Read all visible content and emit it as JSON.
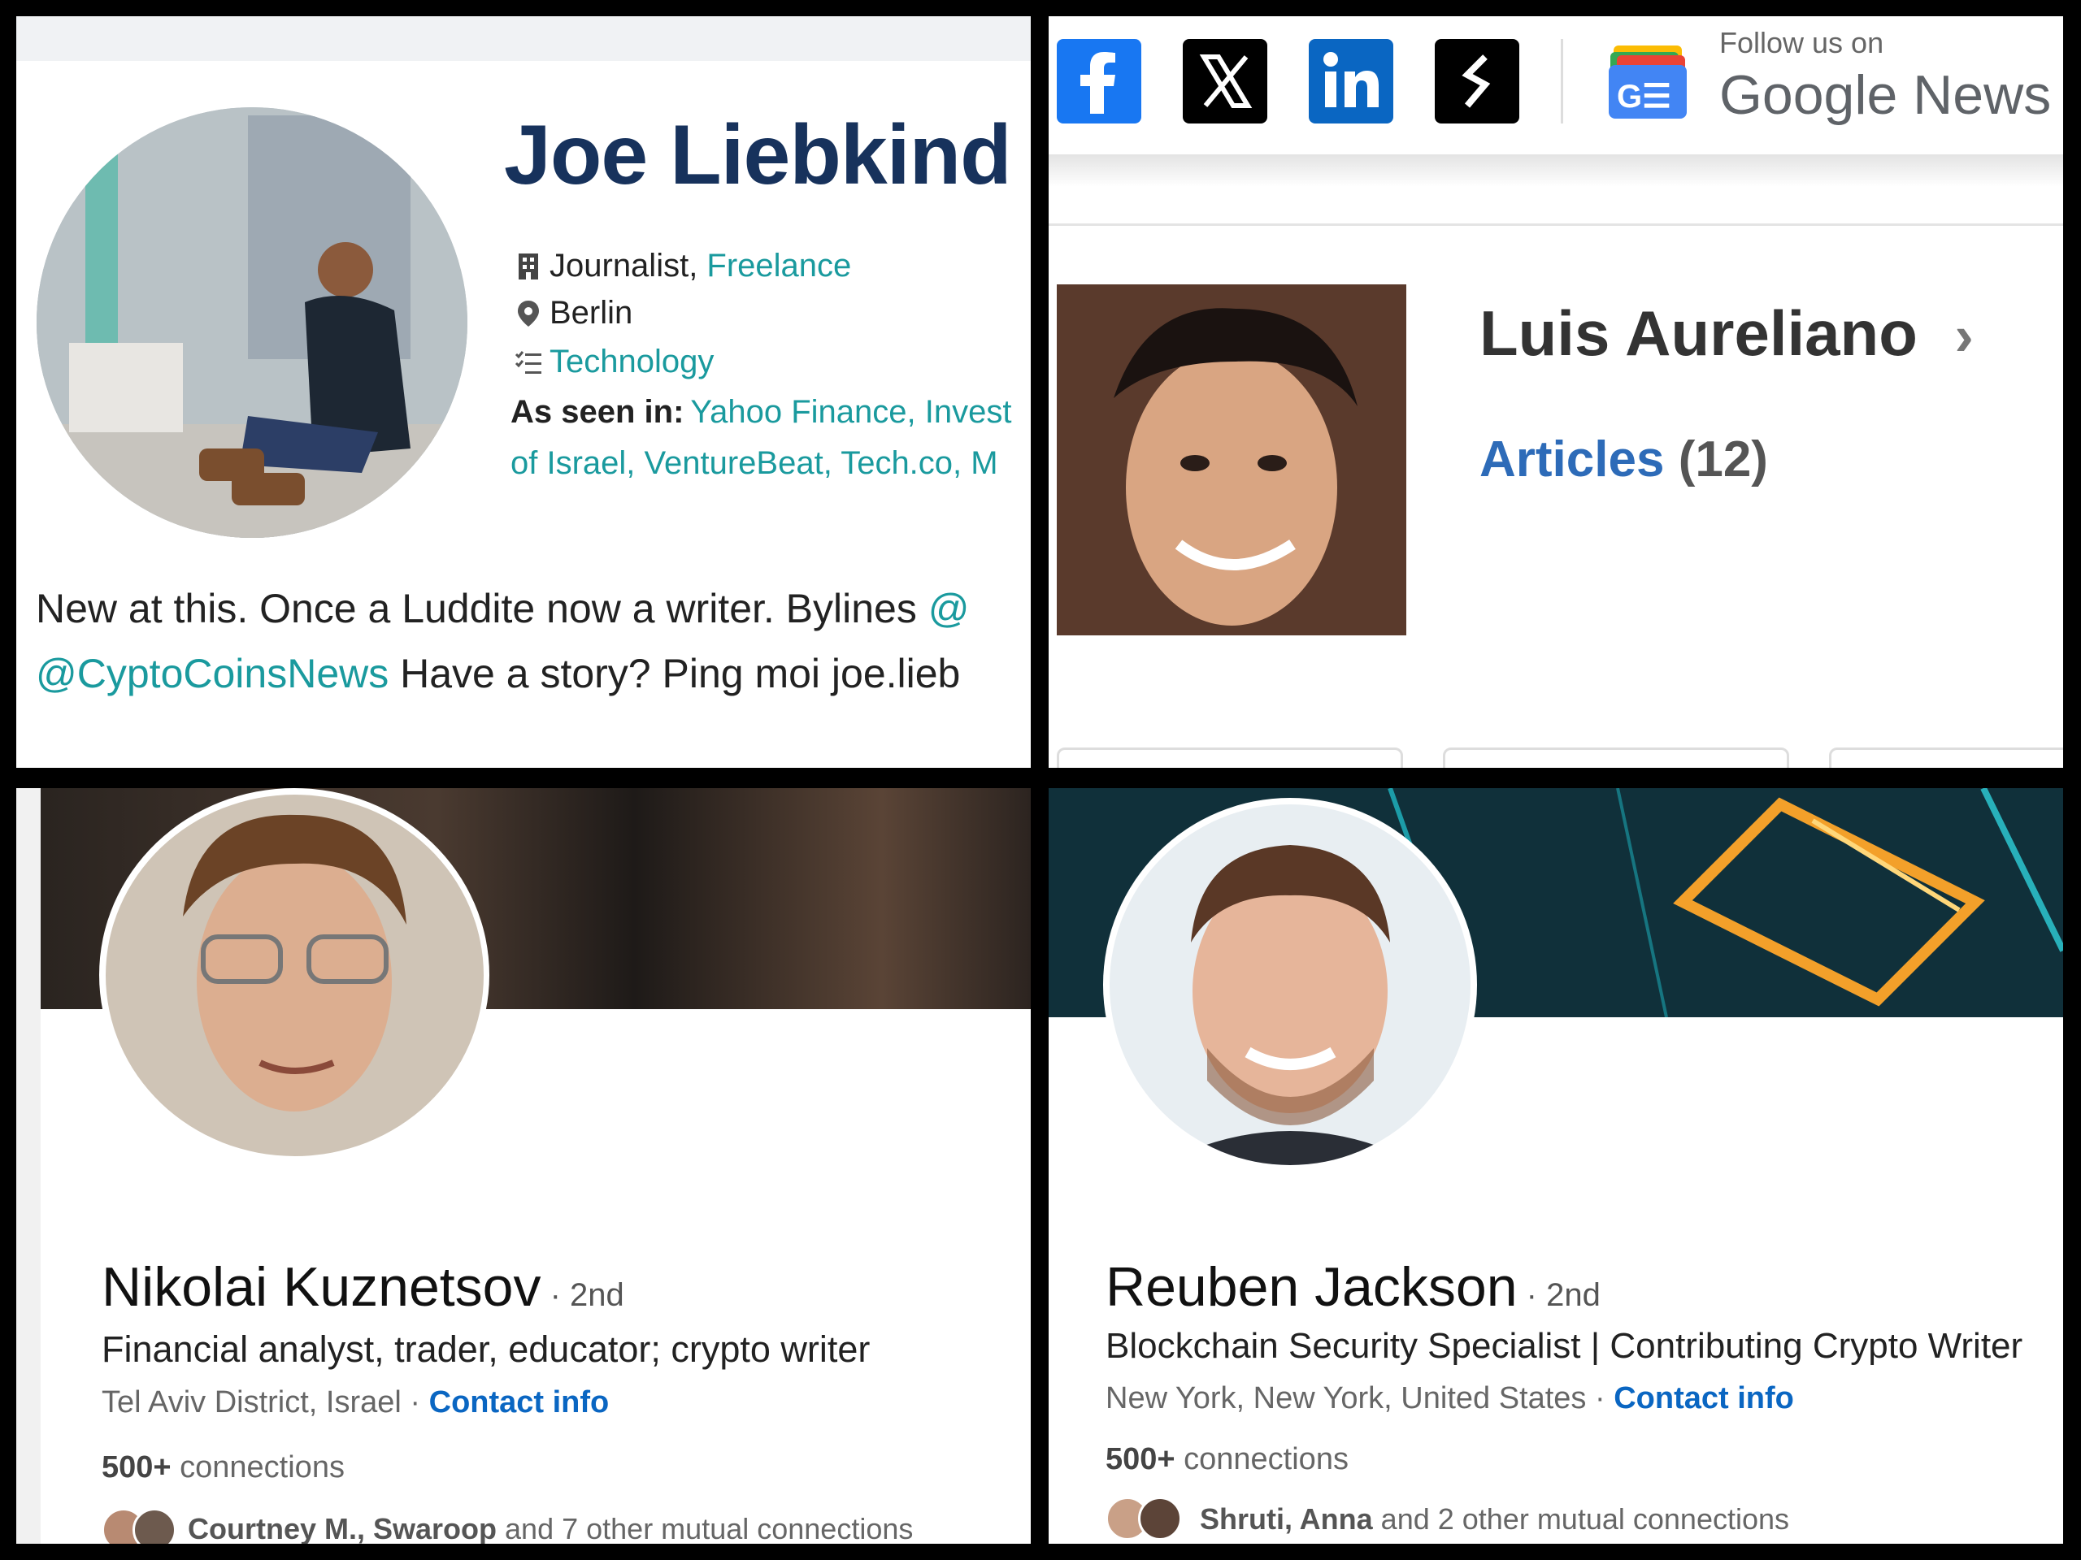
{
  "panel_tl": {
    "name": "Joe Liebkind",
    "role": "Journalist, ",
    "employer": "Freelance",
    "location": "Berlin",
    "topic": "Technology",
    "seen_in_label": "As seen in:",
    "seen_in_line1": "Yahoo Finance, Invest",
    "seen_in_line2": "of Israel, VentureBeat, Tech.co, M",
    "bio_line1_text": "New at this. Once a Luddite now a writer. Bylines ",
    "bio_line1_link": "@",
    "bio_line2_link": "@CyptoCoinsNews",
    "bio_line2_text": " Have a story? Ping moi joe.lieb"
  },
  "panel_tr": {
    "social_icons": [
      "facebook-icon",
      "x-icon",
      "linkedin-icon",
      "substack-icon"
    ],
    "follow_small": "Follow us on",
    "follow_big": "Google News",
    "google_news_icon_text": "G☰",
    "name": "Luis Aureliano",
    "chevron": "›",
    "articles_label": "Articles",
    "articles_count": "(12)"
  },
  "panel_bl": {
    "name": "Nikolai Kuznetsov",
    "degree": " · 2nd",
    "headline": "Financial analyst, trader, educator; crypto writer",
    "location": "Tel Aviv District, Israel",
    "sep": " · ",
    "contact": "Contact info",
    "connections_num": "500+",
    "connections_label": " connections",
    "mutual_names": "Courtney M., Swaroop",
    "mutual_rest": " and 7 other mutual connections"
  },
  "panel_br": {
    "name": "Reuben Jackson",
    "degree": " · 2nd",
    "headline": "Blockchain Security Specialist | Contributing Crypto Writer",
    "location": "New York, New York, United States",
    "sep": " · ",
    "contact": "Contact info",
    "connections_num": "500+",
    "connections_label": " connections",
    "mutual_names": "Shruti, Anna",
    "mutual_rest": " and 2 other mutual connections"
  },
  "colors": {
    "teal_link": "#1a9a9e",
    "navy_name": "#17325c",
    "linkedin_blue": "#0a66c2",
    "facebook": "#1877f2",
    "linkedin_icon": "#0a66c2"
  }
}
